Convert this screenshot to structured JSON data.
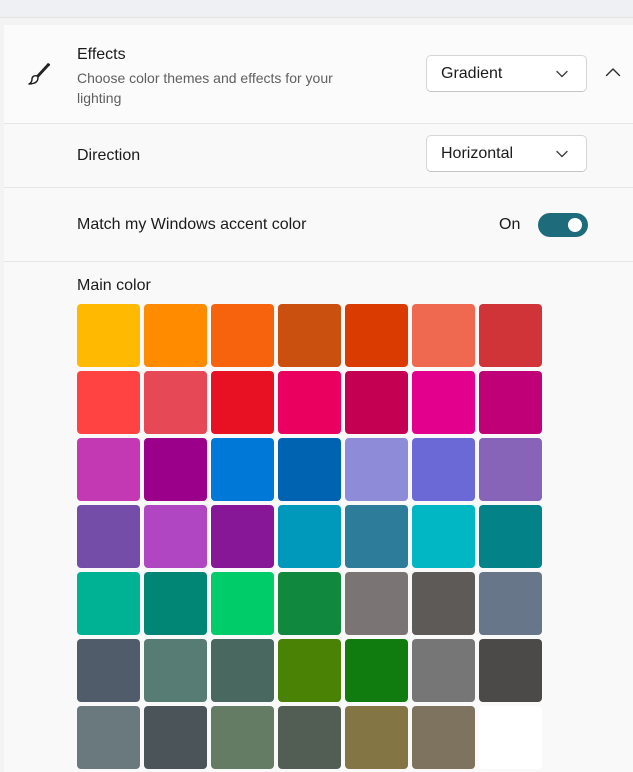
{
  "effects": {
    "title": "Effects",
    "description": "Choose color themes and effects for your lighting",
    "icon": "brush-icon",
    "dropdown_value": "Gradient",
    "collapse_icon": "chevron-up-icon"
  },
  "direction": {
    "label": "Direction",
    "dropdown_value": "Horizontal"
  },
  "accent_match": {
    "label": "Match my Windows accent color",
    "state_label": "On",
    "enabled": true,
    "toggle_color": "#1e6b7b"
  },
  "main_color": {
    "label": "Main color",
    "swatches": [
      "#FFB900",
      "#FF8C00",
      "#F7630C",
      "#CA5010",
      "#DA3B01",
      "#EF6950",
      "#D13438",
      "#FF4343",
      "#E74856",
      "#E81123",
      "#EA005E",
      "#C30052",
      "#E3008C",
      "#BF0077",
      "#C239B3",
      "#9A0089",
      "#0078D7",
      "#0063B1",
      "#8E8CD8",
      "#6B69D6",
      "#8764B8",
      "#744DA9",
      "#B146C2",
      "#881798",
      "#0099BC",
      "#2D7D9A",
      "#00B7C3",
      "#038387",
      "#00B294",
      "#018574",
      "#00CC6A",
      "#10893E",
      "#7A7574",
      "#5D5A58",
      "#68768A",
      "#515C6B",
      "#567C73",
      "#486860",
      "#498205",
      "#107C10",
      "#767676",
      "#4C4A48",
      "#69797E",
      "#4A5459",
      "#647C64",
      "#525E54",
      "#847545",
      "#7E735F",
      "#FFFFFF"
    ]
  }
}
